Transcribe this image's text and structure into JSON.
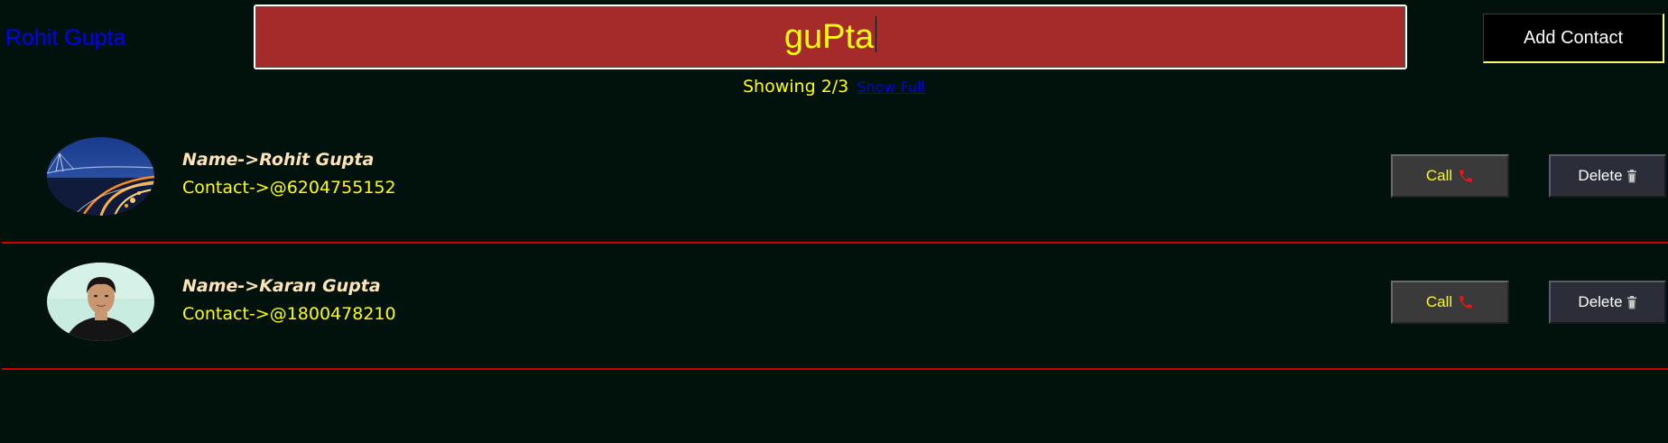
{
  "header": {
    "brand": "Rohit Gupta",
    "search_value": "guPta",
    "add_contact_label": "Add Contact"
  },
  "results": {
    "showing_text": "Showing 2/3",
    "show_full_label": "Show Full"
  },
  "contacts": [
    {
      "name_text": "Name->Rohit Gupta",
      "contact_text": "Contact->@6204755152",
      "call_label": "Call",
      "delete_label": "Delete",
      "avatar_icon": "bridge-photo"
    },
    {
      "name_text": "Name->Karan Gupta",
      "contact_text": "Contact->@1800478210",
      "call_label": "Call",
      "delete_label": "Delete",
      "avatar_icon": "person-photo"
    }
  ],
  "icons": {
    "call": "phone-icon",
    "delete": "trash-icon"
  },
  "colors": {
    "background": "#00120b",
    "brand": "#0000ff",
    "search_bg": "#a52a2a",
    "search_text": "#ffff00",
    "name_text": "#ffe4b5",
    "contact_text": "#ffff00",
    "divider": "#cc0000",
    "call_text": "#ffff00"
  }
}
